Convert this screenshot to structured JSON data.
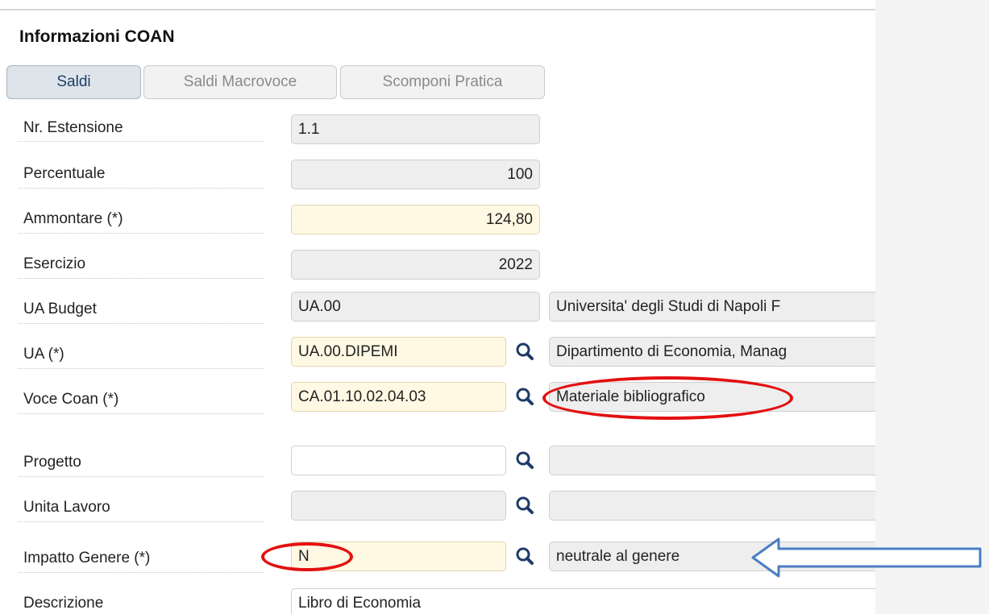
{
  "section": {
    "title": "Informazioni COAN"
  },
  "tabs": [
    {
      "label": "Saldi",
      "active": true
    },
    {
      "label": "Saldi Macrovoce",
      "active": false
    },
    {
      "label": "Scomponi Pratica",
      "active": false
    }
  ],
  "rows": {
    "nr_estensione": {
      "label": "Nr. Estensione",
      "value": "1.1"
    },
    "percentuale": {
      "label": "Percentuale",
      "value": "100"
    },
    "ammontare": {
      "label": "Ammontare (*)",
      "value": "124,80"
    },
    "esercizio": {
      "label": "Esercizio",
      "value": "2022"
    },
    "ua_budget": {
      "label": "UA Budget",
      "value": "UA.00",
      "description": "Universita' degli Studi di Napoli F"
    },
    "ua": {
      "label": "UA (*)",
      "value": "UA.00.DIPEMI",
      "description": "Dipartimento di Economia, Manag"
    },
    "voce_coan": {
      "label": "Voce Coan (*)",
      "value": "CA.01.10.02.04.03",
      "description": "Materiale bibliografico"
    },
    "progetto": {
      "label": "Progetto",
      "value": "",
      "description": ""
    },
    "unita_lavoro": {
      "label": "Unita Lavoro",
      "value": "",
      "description": ""
    },
    "impatto_genere": {
      "label": "Impatto Genere (*)",
      "value": "N",
      "description": "neutrale al genere"
    },
    "descrizione": {
      "label": "Descrizione",
      "value": "Libro di Economia"
    }
  },
  "icons": {
    "lookup": "search-icon"
  },
  "colors": {
    "required_bg": "#fff8e3",
    "readonly_bg": "#eeeeee",
    "highlight_red": "#e31010",
    "arrow_blue": "#4a7ec2"
  }
}
